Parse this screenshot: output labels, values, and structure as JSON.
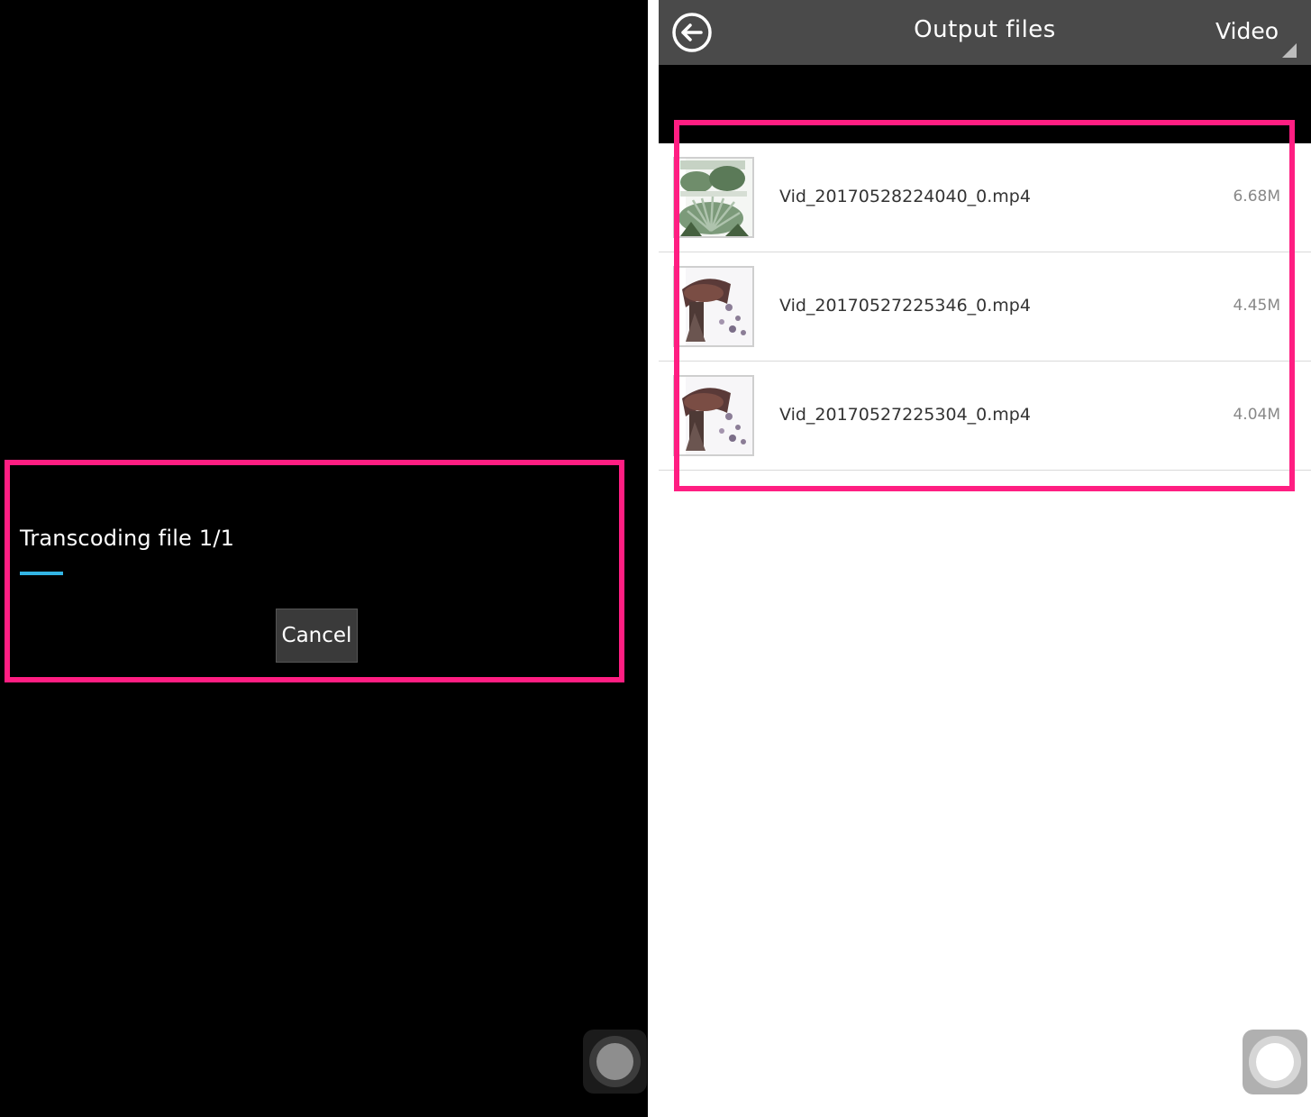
{
  "left_screen": {
    "dialog": {
      "message": "Transcoding file 1/1",
      "progress_fraction": 0.075,
      "cancel_label": "Cancel"
    },
    "assistive_touch_icon": "assistive-touch-icon"
  },
  "right_screen": {
    "header": {
      "back_icon": "back-arrow-icon",
      "title": "Output files",
      "filter_label": "Video"
    },
    "files": [
      {
        "name": "Vid_20170528224040_0.mp4",
        "size": "6.68M",
        "thumbnail": "garden-plants-thumbnail"
      },
      {
        "name": "Vid_20170527225346_0.mp4",
        "size": "4.45M",
        "thumbnail": "fountain-sculpture-thumbnail"
      },
      {
        "name": "Vid_20170527225304_0.mp4",
        "size": "4.04M",
        "thumbnail": "fountain-sculpture-thumbnail"
      }
    ],
    "assistive_touch_icon": "assistive-touch-icon"
  },
  "colors": {
    "annotation_highlight": "#ff1e82",
    "progress_accent": "#33b5e5",
    "titlebar_bg": "#4a4a4a"
  }
}
